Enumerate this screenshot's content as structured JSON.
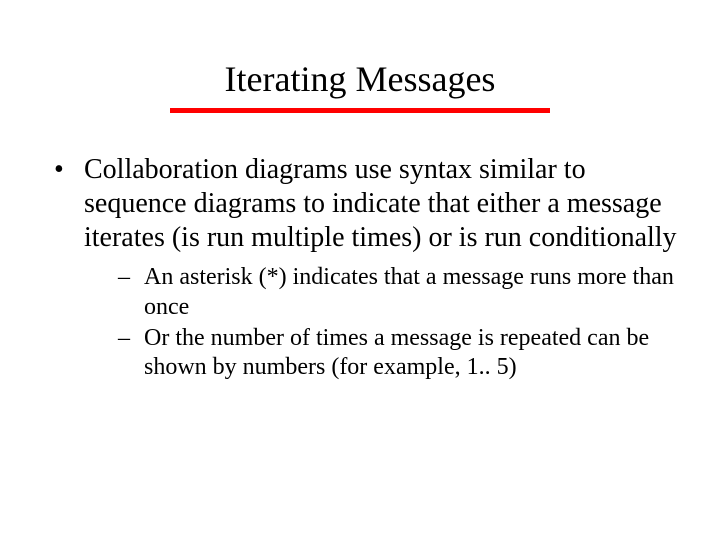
{
  "title": "Iterating Messages",
  "bullets": {
    "main": "Collaboration diagrams use syntax similar to sequence diagrams to indicate that either a message iterates (is run multiple times) or is run conditionally",
    "subs": [
      "An asterisk (*) indicates that a message runs more than once",
      "Or the number of times a message is repeated can be shown by numbers (for example, 1.. 5)"
    ]
  }
}
